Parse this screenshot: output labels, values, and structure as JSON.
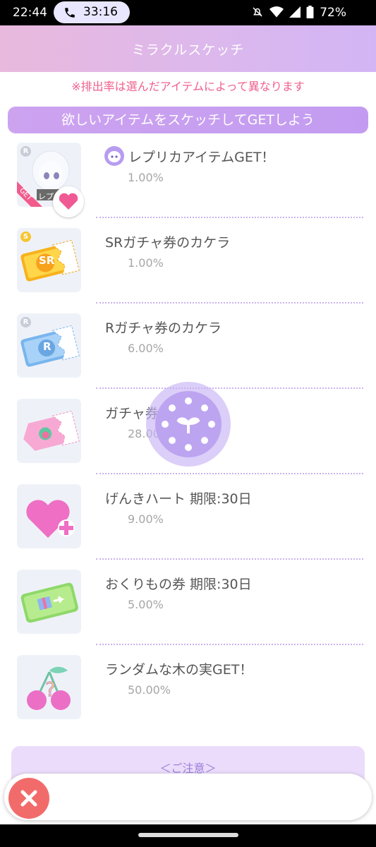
{
  "status": {
    "time": "22:44",
    "call_duration": "33:16",
    "battery": "72%",
    "icons": [
      "phone-icon",
      "mute-icon",
      "wifi-icon",
      "signal-icon",
      "battery-icon"
    ]
  },
  "header": {
    "title": "ミラクルスケッチ"
  },
  "notice": "※排出率は選んだアイテムによって異なります",
  "banner": "欲しいアイテムをスケッチしてGETしよう",
  "items": [
    {
      "name": "レプリカアイテムGET！",
      "rate": "1.00%",
      "rarity": "R",
      "tag": "GET",
      "thumb_label": "レプリ",
      "icon": "replica-avatar-icon"
    },
    {
      "name": "SRガチャ券のカケラ",
      "rate": "1.00%",
      "rarity": "S",
      "ticket_label": "SR",
      "icon": "sr-ticket-piece-icon"
    },
    {
      "name": "Rガチャ券のカケラ",
      "rate": "6.00%",
      "rarity": "R",
      "ticket_label": "R",
      "icon": "r-ticket-piece-icon"
    },
    {
      "name": "ガチャ券のカケラ",
      "rate": "28.00%",
      "icon": "gacha-ticket-piece-icon"
    },
    {
      "name": "げんきハート 期限:30日",
      "rate": "9.00%",
      "icon": "heart-plus-icon"
    },
    {
      "name": "おくりもの券 期限:30日",
      "rate": "5.00%",
      "icon": "gift-ticket-icon"
    },
    {
      "name": "ランダムな木の実GET！",
      "rate": "50.00%",
      "icon": "mystery-cherry-icon"
    }
  ],
  "caution": {
    "title": "＜ご注意＞"
  },
  "colors": {
    "accent": "#c39cf1",
    "notice": "#f0608e",
    "close": "#f26b6b"
  }
}
